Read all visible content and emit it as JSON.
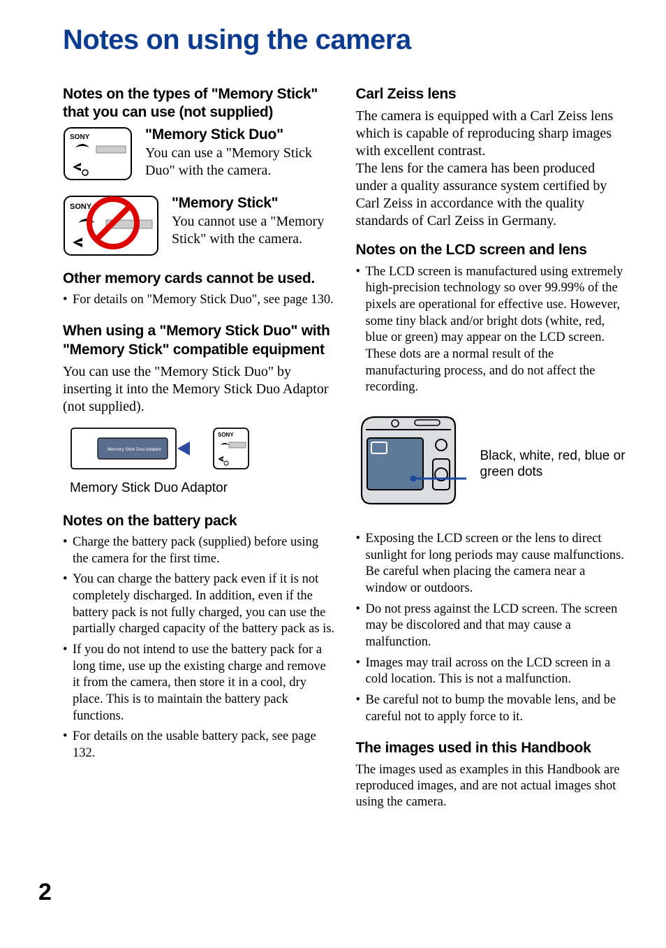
{
  "title": "Notes on using the camera",
  "left": {
    "h_memstick_types": "Notes on the types of \"Memory Stick\" that you can use (not supplied)",
    "msduo_head": "\"Memory Stick Duo\"",
    "msduo_body": "You can use a \"Memory Stick Duo\" with the camera.",
    "ms_head": "\"Memory Stick\"",
    "ms_body": "You cannot use a \"Memory Stick\" with the camera.",
    "h_other_cards": "Other memory cards cannot be used.",
    "other_cards_bullets": [
      "For details on \"Memory Stick Duo\", see page 130."
    ],
    "h_adaptor": "When using a \"Memory Stick Duo\" with \"Memory Stick\" compatible equipment",
    "adaptor_body": "You can use the \"Memory Stick Duo\" by inserting it into the Memory Stick Duo Adaptor (not supplied).",
    "adaptor_caption": "Memory Stick Duo Adaptor",
    "h_battery": "Notes on the battery pack",
    "battery_bullets": [
      "Charge the battery pack (supplied) before using the camera for the first time.",
      "You can charge the battery pack even if it is not completely discharged. In addition, even if the battery pack is not fully charged, you can use the partially charged capacity of the battery pack as is.",
      "If you do not intend to use the battery pack for a long time, use up the existing charge and remove it from the camera, then store it in a cool, dry place. This is to maintain the battery pack functions.",
      "For details on the usable battery pack, see page 132."
    ]
  },
  "right": {
    "h_zeiss": "Carl Zeiss lens",
    "zeiss_p1": "The camera is equipped with a Carl Zeiss lens which is capable of reproducing sharp images with excellent contrast.",
    "zeiss_p2": "The lens for the camera has been produced under a quality assurance system certified by Carl Zeiss in accordance with the quality standards of Carl Zeiss in Germany.",
    "h_lcd": "Notes on the LCD screen and lens",
    "lcd_bullets_top": [
      "The LCD screen is manufactured using extremely high-precision technology so over 99.99% of the pixels are operational for effective use. However, some tiny black and/or bright dots (white, red, blue or green) may appear on the LCD screen. These dots are a normal result of the manufacturing process, and do not affect the recording."
    ],
    "callout": "Black, white, red, blue or green dots",
    "lcd_bullets_bottom": [
      "Exposing the LCD screen or the lens to direct sunlight for long periods may cause malfunctions. Be careful when placing the camera near a window or outdoors.",
      "Do not press against the LCD screen. The screen may be discolored and that may cause a malfunction.",
      "Images may trail across on the LCD screen in a cold location. This is not a malfunction.",
      "Be careful not to bump the movable lens, and be careful not to apply force to it."
    ],
    "h_handbook": "The images used in this Handbook",
    "handbook_body": "The images used as examples in this Handbook are reproduced images, and are not actual images shot using the camera."
  },
  "page_number": "2"
}
